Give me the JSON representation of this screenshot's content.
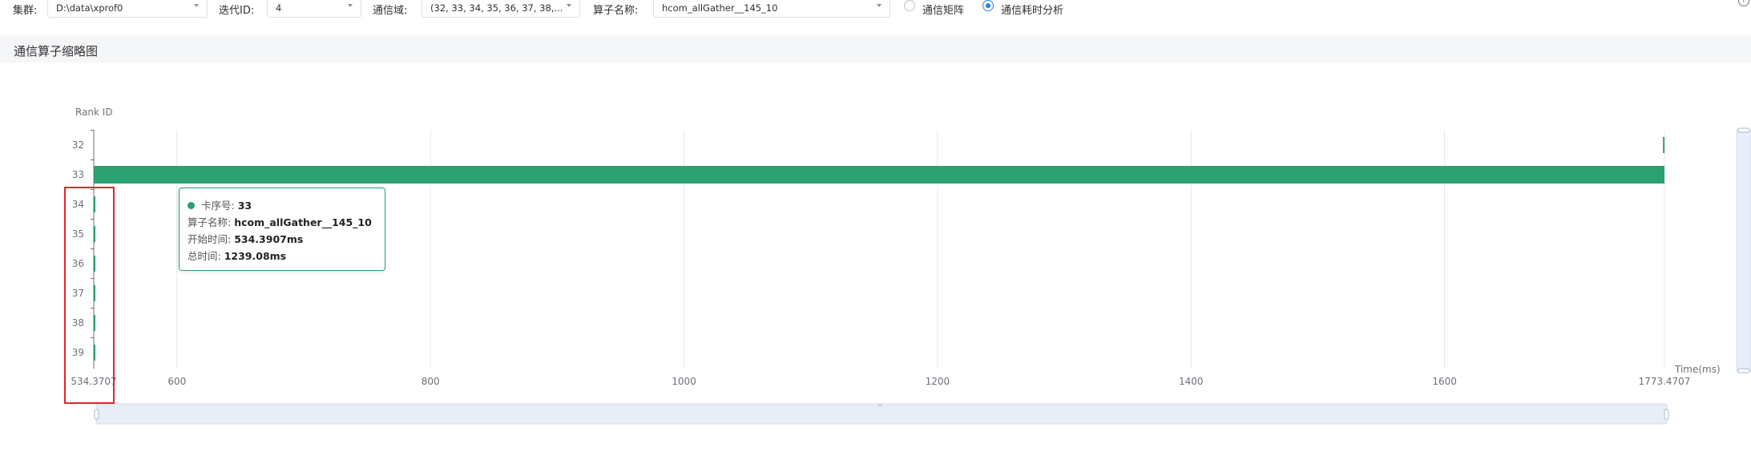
{
  "toolbar": {
    "cluster_label": "集群:",
    "cluster_value": "D:\\data\\xprof0",
    "iteration_label": "迭代ID:",
    "iteration_value": "4",
    "domain_label": "通信域:",
    "domain_value": "(32, 33, 34, 35, 36, 37, 38,...",
    "operator_label": "算子名称:",
    "operator_value": "hcom_allGather__145_10",
    "radio_matrix_label": "通信矩阵",
    "radio_time_label": "通信耗时分析",
    "radio_selected": "time",
    "help_glyph": "?"
  },
  "section": {
    "title": "通信算子缩略图"
  },
  "tooltip": {
    "rank_label": "卡序号:",
    "rank_value": "33",
    "name_label": "算子名称:",
    "name_value": "hcom_allGather__145_10",
    "start_label": "开始时间:",
    "start_value": "534.3907ms",
    "total_label": "总时间:",
    "total_value": "1239.08ms"
  },
  "colors": {
    "bar": "#2ca071",
    "accent": "#2b7fe0",
    "highlight": "#e0242b"
  },
  "chart_data": {
    "type": "bar",
    "orientation": "horizontal-timeline",
    "ylabel": "Rank ID",
    "xlabel": "Time(ms)",
    "xlim": [
      534.3707,
      1773.4707
    ],
    "x_ticks": [
      "534.3707",
      "600",
      "800",
      "1000",
      "1200",
      "1400",
      "1600",
      "1773.4707"
    ],
    "x_tick_values": [
      534.3707,
      600,
      800,
      1000,
      1200,
      1400,
      1600,
      1773.4707
    ],
    "categories": [
      "32",
      "33",
      "34",
      "35",
      "36",
      "37",
      "38",
      "39"
    ],
    "series": [
      {
        "values": [
          {
            "rank": "32",
            "start": 1772.3,
            "duration": 1.1
          },
          {
            "rank": "33",
            "start": 534.3907,
            "duration": 1239.08
          },
          {
            "rank": "34",
            "start": 534.3707,
            "duration": 1.2
          },
          {
            "rank": "35",
            "start": 534.3707,
            "duration": 1.2
          },
          {
            "rank": "36",
            "start": 534.3707,
            "duration": 1.2
          },
          {
            "rank": "37",
            "start": 534.3707,
            "duration": 1.2
          },
          {
            "rank": "38",
            "start": 534.3707,
            "duration": 1.2
          },
          {
            "rank": "39",
            "start": 534.3707,
            "duration": 1.2
          }
        ]
      }
    ],
    "grid": true
  }
}
